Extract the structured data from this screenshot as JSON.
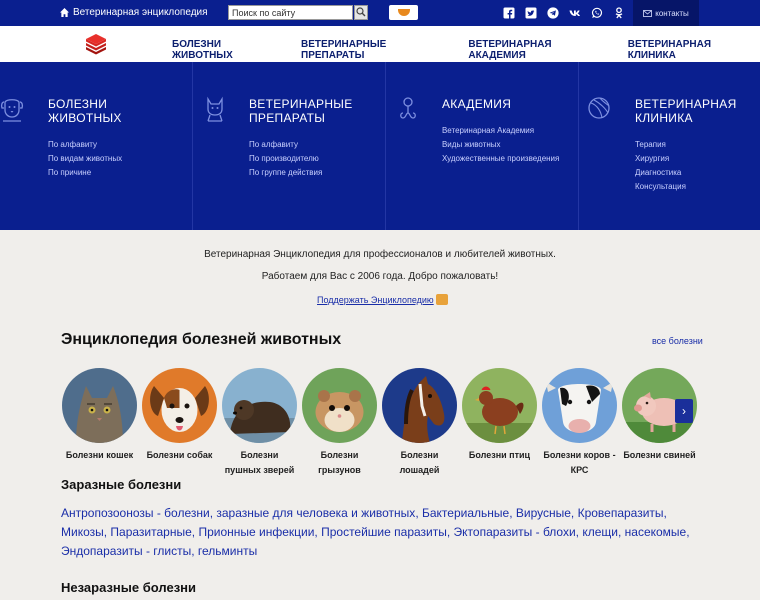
{
  "topbar": {
    "home_label": "Ветеринарная энциклопедия",
    "search_value": "Поиск по сайту",
    "contacts_label": "контакты",
    "social": [
      "facebook-icon",
      "twitter-icon",
      "telegram-icon",
      "vk-icon",
      "whatsapp-icon",
      "odnoklassniki-icon"
    ]
  },
  "nav": {
    "items": [
      "БОЛЕЗНИ ЖИВОТНЫХ",
      "ВЕТЕРИНАРНЫЕ ПРЕПАРАТЫ",
      "ВЕТЕРИНАРНАЯ АКАДЕМИЯ",
      "ВЕТЕРИНАРНАЯ КЛИНИКА"
    ]
  },
  "mega": [
    {
      "title": "Болезни животных",
      "icon": "dog-icon",
      "links": [
        "По алфавиту",
        "По видам животных",
        "По причине"
      ]
    },
    {
      "title": "Ветеринарные препараты",
      "icon": "cat-icon",
      "links": [
        "По алфавиту",
        "По производителю",
        "По группе действия"
      ]
    },
    {
      "title": "Академия",
      "icon": "stethoscope-icon",
      "links": [
        "Ветеринарная Академия",
        "Виды животных",
        "Художественные произведения"
      ]
    },
    {
      "title": "Ветеринарная клиника",
      "icon": "yarn-ball-icon",
      "links": [
        "Терапия",
        "Хирургия",
        "Диагностика",
        "Консультация"
      ]
    }
  ],
  "intro": {
    "line1": "Ветеринарная Энциклопедия для профессионалов и любителей животных.",
    "line2": "Работаем для Вас с 2006 года. Добро пожаловать!",
    "support": "Поддержать Энциклопедию"
  },
  "encyclopedia": {
    "title": "Энциклопедия болезней животных",
    "all_link": "все болезни",
    "animals": [
      {
        "label": "Болезни кошек",
        "color": "#8a7a66"
      },
      {
        "label": "Болезни собак",
        "color": "#e07a2a"
      },
      {
        "label": "Болезни пушных зверей",
        "color": "#5b4531"
      },
      {
        "label": "Болезни грызунов",
        "color": "#b88a58"
      },
      {
        "label": "Болезни лошадей",
        "color": "#6a3a1e"
      },
      {
        "label": "Болезни птиц",
        "color": "#8b3f1f"
      },
      {
        "label": "Болезни коров - КРС",
        "color": "#d6dbe6"
      },
      {
        "label": "Болезни свиней",
        "color": "#e7b8b0"
      }
    ]
  },
  "contagious": {
    "title": "Заразные болезни",
    "tags": [
      "Антропозоонозы - болезни, заразные для человека и животных",
      "Бактериальные",
      "Вирусные",
      "Кровепаразиты",
      "Микозы",
      "Паразитарные",
      "Прионные инфекции",
      "Простейшие паразиты",
      "Эктопаразиты - блохи, клещи, насекомые",
      "Эндопаразиты - глисты, гельминты"
    ]
  },
  "noncontagious": {
    "title": "Незаразные болезни"
  }
}
